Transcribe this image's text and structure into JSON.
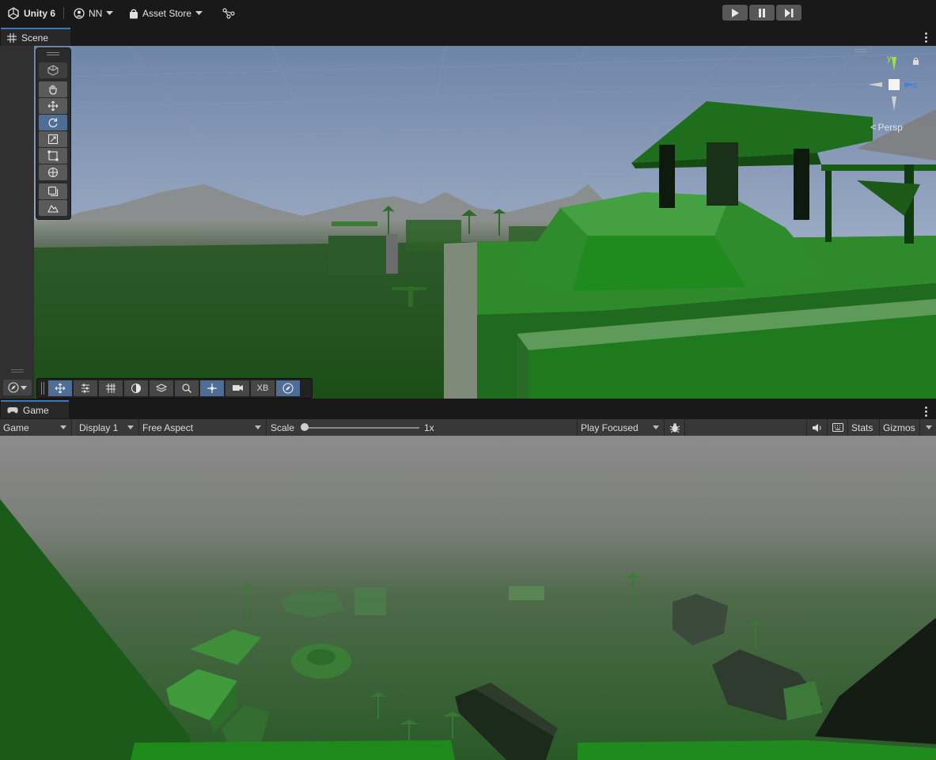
{
  "topbar": {
    "app_title": "Unity 6",
    "account": "NN",
    "asset_store": "Asset Store",
    "icons": [
      "unity-logo-icon",
      "account-icon",
      "asset-store-bag-icon",
      "version-control-icon",
      "play-icon",
      "pause-icon",
      "step-icon"
    ]
  },
  "scene": {
    "tab_label": "Scene",
    "camera_mode": "Persp",
    "gizmo_axes": {
      "y": "y",
      "z": "z"
    },
    "tools": [
      "view-tool",
      "hand-tool",
      "move-tool",
      "rotate-tool",
      "scale-tool",
      "rect-tool",
      "transform-tool",
      "custom-tool",
      "terrain-tool"
    ],
    "active_tool": "rotate-tool",
    "overlay_toggle_label": "XB"
  },
  "game": {
    "tab_label": "Game",
    "view_mode": "Game",
    "display": "Display 1",
    "aspect": "Free Aspect",
    "scale_label": "Scale",
    "scale_value": "1x",
    "play_mode": "Play Focused",
    "stats_label": "Stats",
    "gizmos_label": "Gizmos"
  },
  "colors": {
    "accent_blue": "#3a79bb",
    "active_tool": "#4e6e96",
    "panel_bg": "#191919",
    "toolbar_bg": "#383838",
    "ground_green": "#1f6a1e"
  }
}
